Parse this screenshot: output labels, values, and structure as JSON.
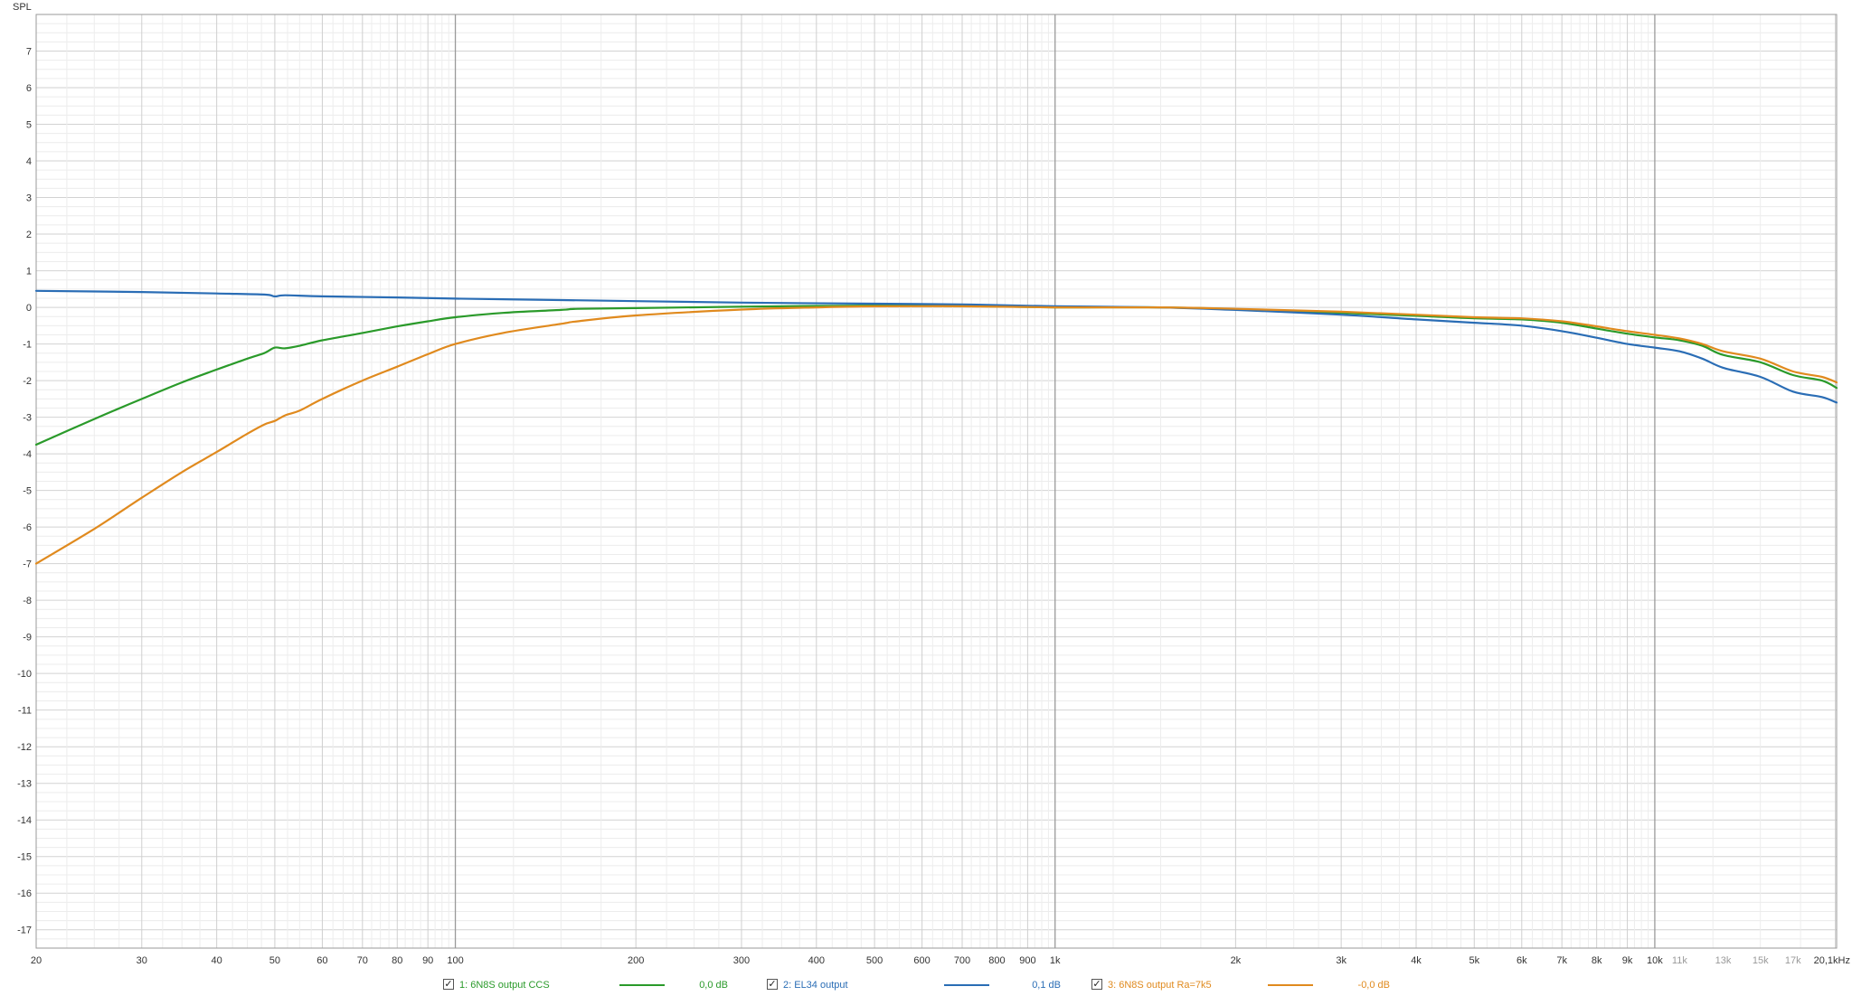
{
  "chart_data": {
    "type": "line",
    "ylabel": "SPL",
    "xunit": "kHz",
    "xscale": "log",
    "xlim": [
      20,
      20100
    ],
    "ylim": [
      -17.5,
      8
    ],
    "y_ticks": [
      7,
      6,
      5,
      4,
      3,
      2,
      1,
      0,
      -1,
      -2,
      -3,
      -4,
      -5,
      -6,
      -7,
      -8,
      -9,
      -10,
      -11,
      -12,
      -13,
      -14,
      -15,
      -16,
      -17
    ],
    "x_ticks": [
      {
        "v": 20,
        "label": "20",
        "muted": false
      },
      {
        "v": 30,
        "label": "30",
        "muted": false
      },
      {
        "v": 40,
        "label": "40",
        "muted": false
      },
      {
        "v": 50,
        "label": "50",
        "muted": false
      },
      {
        "v": 60,
        "label": "60",
        "muted": false
      },
      {
        "v": 70,
        "label": "70",
        "muted": false
      },
      {
        "v": 80,
        "label": "80",
        "muted": false
      },
      {
        "v": 90,
        "label": "90",
        "muted": false
      },
      {
        "v": 100,
        "label": "100",
        "muted": false
      },
      {
        "v": 200,
        "label": "200",
        "muted": false
      },
      {
        "v": 300,
        "label": "300",
        "muted": false
      },
      {
        "v": 400,
        "label": "400",
        "muted": false
      },
      {
        "v": 500,
        "label": "500",
        "muted": false
      },
      {
        "v": 600,
        "label": "600",
        "muted": false
      },
      {
        "v": 700,
        "label": "700",
        "muted": false
      },
      {
        "v": 800,
        "label": "800",
        "muted": false
      },
      {
        "v": 900,
        "label": "900",
        "muted": false
      },
      {
        "v": 1000,
        "label": "1k",
        "muted": false
      },
      {
        "v": 2000,
        "label": "2k",
        "muted": false
      },
      {
        "v": 3000,
        "label": "3k",
        "muted": false
      },
      {
        "v": 4000,
        "label": "4k",
        "muted": false
      },
      {
        "v": 5000,
        "label": "5k",
        "muted": false
      },
      {
        "v": 6000,
        "label": "6k",
        "muted": false
      },
      {
        "v": 7000,
        "label": "7k",
        "muted": false
      },
      {
        "v": 8000,
        "label": "8k",
        "muted": false
      },
      {
        "v": 9000,
        "label": "9k",
        "muted": false
      },
      {
        "v": 10000,
        "label": "10k",
        "muted": false
      },
      {
        "v": 11000,
        "label": "11k",
        "muted": true
      },
      {
        "v": 13000,
        "label": "13k",
        "muted": true
      },
      {
        "v": 15000,
        "label": "15k",
        "muted": true
      },
      {
        "v": 17000,
        "label": "17k",
        "muted": true
      },
      {
        "v": 20100,
        "label": "20,1kHz",
        "muted": false
      }
    ],
    "grid": true,
    "legend_position": "bottom",
    "series": [
      {
        "name": "1: 6N8S output CCS",
        "value_label": "0,0 dB",
        "color": "#2a9a2a",
        "checked": true,
        "points": [
          [
            20,
            -3.75
          ],
          [
            25,
            -3.05
          ],
          [
            30,
            -2.5
          ],
          [
            35,
            -2.05
          ],
          [
            40,
            -1.7
          ],
          [
            45,
            -1.4
          ],
          [
            48,
            -1.25
          ],
          [
            50,
            -1.1
          ],
          [
            52,
            -1.12
          ],
          [
            55,
            -1.05
          ],
          [
            60,
            -0.9
          ],
          [
            70,
            -0.7
          ],
          [
            80,
            -0.52
          ],
          [
            90,
            -0.38
          ],
          [
            100,
            -0.27
          ],
          [
            120,
            -0.15
          ],
          [
            150,
            -0.07
          ],
          [
            160,
            -0.04
          ],
          [
            200,
            -0.02
          ],
          [
            300,
            0.02
          ],
          [
            500,
            0.05
          ],
          [
            700,
            0.04
          ],
          [
            1000,
            0.0
          ],
          [
            1500,
            0.0
          ],
          [
            2000,
            -0.05
          ],
          [
            3000,
            -0.15
          ],
          [
            4000,
            -0.23
          ],
          [
            5000,
            -0.3
          ],
          [
            6000,
            -0.33
          ],
          [
            7000,
            -0.42
          ],
          [
            8000,
            -0.58
          ],
          [
            9000,
            -0.72
          ],
          [
            10000,
            -0.82
          ],
          [
            11000,
            -0.9
          ],
          [
            12000,
            -1.05
          ],
          [
            13000,
            -1.3
          ],
          [
            15000,
            -1.5
          ],
          [
            17000,
            -1.85
          ],
          [
            19000,
            -2.0
          ],
          [
            20100,
            -2.2
          ]
        ]
      },
      {
        "name": "2: EL34 output",
        "value_label": "0,1 dB",
        "color": "#2a6db5",
        "checked": true,
        "points": [
          [
            20,
            0.45
          ],
          [
            30,
            0.42
          ],
          [
            40,
            0.38
          ],
          [
            48,
            0.35
          ],
          [
            50,
            0.3
          ],
          [
            52,
            0.33
          ],
          [
            60,
            0.3
          ],
          [
            80,
            0.27
          ],
          [
            100,
            0.24
          ],
          [
            150,
            0.2
          ],
          [
            200,
            0.17
          ],
          [
            300,
            0.13
          ],
          [
            500,
            0.1
          ],
          [
            700,
            0.08
          ],
          [
            1000,
            0.03
          ],
          [
            1500,
            0.0
          ],
          [
            2000,
            -0.07
          ],
          [
            3000,
            -0.2
          ],
          [
            4000,
            -0.33
          ],
          [
            5000,
            -0.42
          ],
          [
            6000,
            -0.5
          ],
          [
            7000,
            -0.65
          ],
          [
            8000,
            -0.83
          ],
          [
            9000,
            -1.0
          ],
          [
            10000,
            -1.1
          ],
          [
            11000,
            -1.2
          ],
          [
            12000,
            -1.4
          ],
          [
            13000,
            -1.65
          ],
          [
            15000,
            -1.9
          ],
          [
            17000,
            -2.3
          ],
          [
            19000,
            -2.45
          ],
          [
            20100,
            -2.6
          ]
        ]
      },
      {
        "name": "3: 6N8S output Ra=7k5",
        "value_label": "-0,0 dB",
        "color": "#e08a1e",
        "checked": true,
        "points": [
          [
            20,
            -7.0
          ],
          [
            25,
            -6.05
          ],
          [
            30,
            -5.2
          ],
          [
            35,
            -4.5
          ],
          [
            40,
            -3.95
          ],
          [
            45,
            -3.45
          ],
          [
            48,
            -3.2
          ],
          [
            50,
            -3.1
          ],
          [
            52,
            -2.95
          ],
          [
            55,
            -2.82
          ],
          [
            60,
            -2.5
          ],
          [
            70,
            -2.0
          ],
          [
            80,
            -1.62
          ],
          [
            90,
            -1.28
          ],
          [
            100,
            -1.0
          ],
          [
            120,
            -0.7
          ],
          [
            150,
            -0.45
          ],
          [
            160,
            -0.38
          ],
          [
            200,
            -0.22
          ],
          [
            300,
            -0.06
          ],
          [
            400,
            0.0
          ],
          [
            500,
            0.03
          ],
          [
            700,
            0.03
          ],
          [
            1000,
            0.0
          ],
          [
            1500,
            0.0
          ],
          [
            2000,
            -0.04
          ],
          [
            3000,
            -0.12
          ],
          [
            4000,
            -0.2
          ],
          [
            5000,
            -0.27
          ],
          [
            6000,
            -0.3
          ],
          [
            7000,
            -0.38
          ],
          [
            8000,
            -0.52
          ],
          [
            9000,
            -0.65
          ],
          [
            10000,
            -0.75
          ],
          [
            11000,
            -0.85
          ],
          [
            12000,
            -1.0
          ],
          [
            13000,
            -1.2
          ],
          [
            15000,
            -1.4
          ],
          [
            17000,
            -1.75
          ],
          [
            19000,
            -1.9
          ],
          [
            20100,
            -2.05
          ]
        ]
      }
    ]
  }
}
